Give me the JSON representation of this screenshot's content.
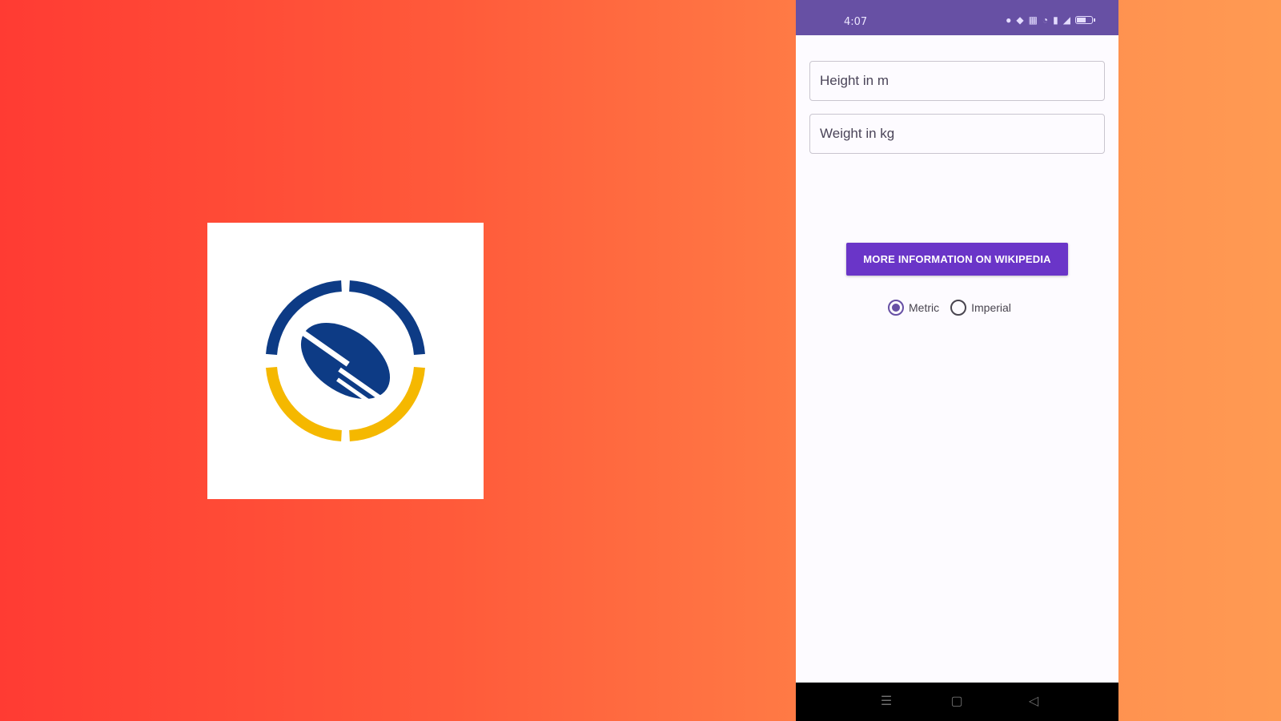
{
  "status_bar": {
    "time": "4:07",
    "background_color": "#6750a4"
  },
  "form": {
    "height_placeholder": "Height in m",
    "height_value": "",
    "weight_placeholder": "Weight in kg",
    "weight_value": ""
  },
  "wiki_button": {
    "label": "MORE INFORMATION ON WIKIPEDIA",
    "color": "#6a35c8"
  },
  "units": {
    "options": [
      {
        "label": "Metric",
        "checked": true
      },
      {
        "label": "Imperial",
        "checked": false
      }
    ]
  },
  "nav_bar": {
    "icons": [
      "menu-icon",
      "home-icon",
      "back-icon"
    ]
  },
  "app_icon": {
    "icon": "app-logo-icon",
    "colors": {
      "blue": "#0d3b85",
      "yellow": "#f5b800"
    }
  }
}
